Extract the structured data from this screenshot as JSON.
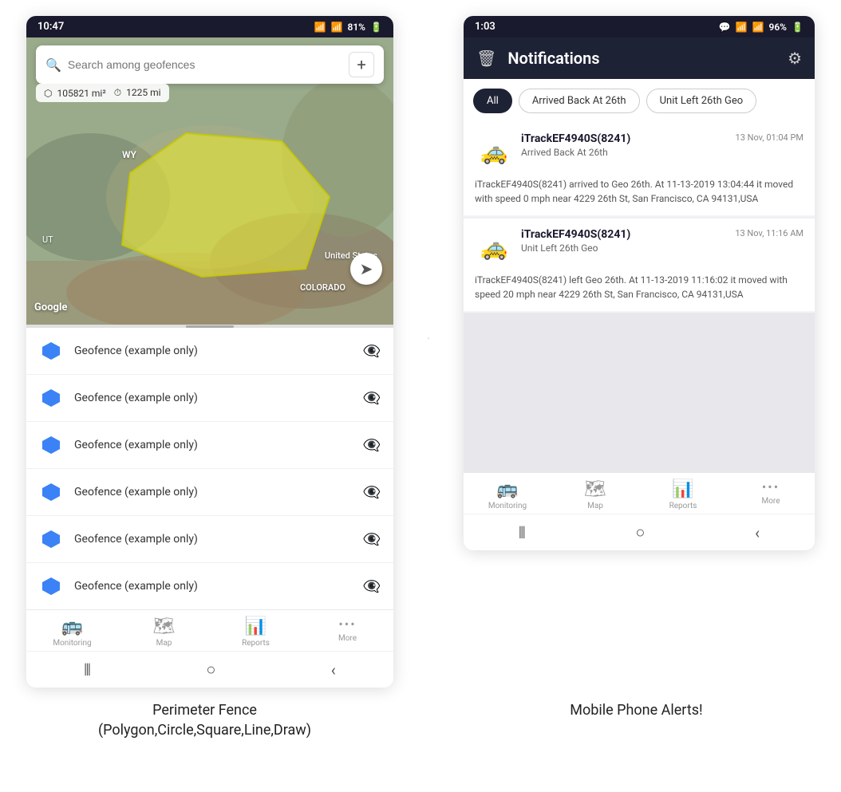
{
  "left_phone": {
    "status_bar": {
      "time": "10:47",
      "wifi": "WiFi",
      "signal": "Signal",
      "battery": "81%"
    },
    "search": {
      "placeholder": "Search among geofences"
    },
    "stats": {
      "area": "105821 mi²",
      "distance": "1225 mi"
    },
    "map_labels": {
      "wy": "WY",
      "ut": "UT",
      "colorado": "COLORADO",
      "us": "United States"
    },
    "geofence_items": [
      {
        "label": "Geofence (example only)"
      },
      {
        "label": "Geofence (example only)"
      },
      {
        "label": "Geofence (example only)"
      },
      {
        "label": "Geofence (example only)"
      },
      {
        "label": "Geofence (example only)"
      },
      {
        "label": "Geofence (example only)"
      }
    ],
    "nav": {
      "items": [
        {
          "label": "Monitoring",
          "icon": "🚌"
        },
        {
          "label": "Map",
          "icon": "🗺"
        },
        {
          "label": "Reports",
          "icon": "📊"
        },
        {
          "label": "More",
          "icon": "···"
        }
      ]
    }
  },
  "right_phone": {
    "status_bar": {
      "time": "1:03",
      "battery": "96%"
    },
    "header": {
      "title": "Notifications",
      "delete_icon": "🗑",
      "settings_icon": "⚙"
    },
    "filter_tabs": [
      {
        "label": "All",
        "active": true
      },
      {
        "label": "Arrived Back At 26th",
        "active": false
      },
      {
        "label": "Unit Left 26th Geo",
        "active": false
      }
    ],
    "notifications": [
      {
        "device": "iTrackEF4940S(8241)",
        "time": "13 Nov, 01:04 PM",
        "event": "Arrived Back At 26th",
        "body": "iTrackEF4940S(8241) arrived to Geo 26th.    At 11-13-2019 13:04:44 it moved with speed 0 mph near 4229 26th St, San Francisco, CA 94131,USA"
      },
      {
        "device": "iTrackEF4940S(8241)",
        "time": "13 Nov, 11:16 AM",
        "event": "Unit Left 26th Geo",
        "body": "iTrackEF4940S(8241) left Geo 26th.    At 11-13-2019 11:16:02 it moved with speed 20 mph near 4229 26th St, San Francisco, CA 94131,USA"
      }
    ],
    "nav": {
      "items": [
        {
          "label": "Monitoring",
          "icon": "🚌"
        },
        {
          "label": "Map",
          "icon": "🗺"
        },
        {
          "label": "Reports",
          "icon": "📊"
        },
        {
          "label": "More",
          "icon": "···"
        }
      ]
    }
  },
  "captions": {
    "left": "Perimeter Fence\n(Polygon,Circle,Square,Line,Draw)",
    "right": "Mobile Phone Alerts!"
  }
}
